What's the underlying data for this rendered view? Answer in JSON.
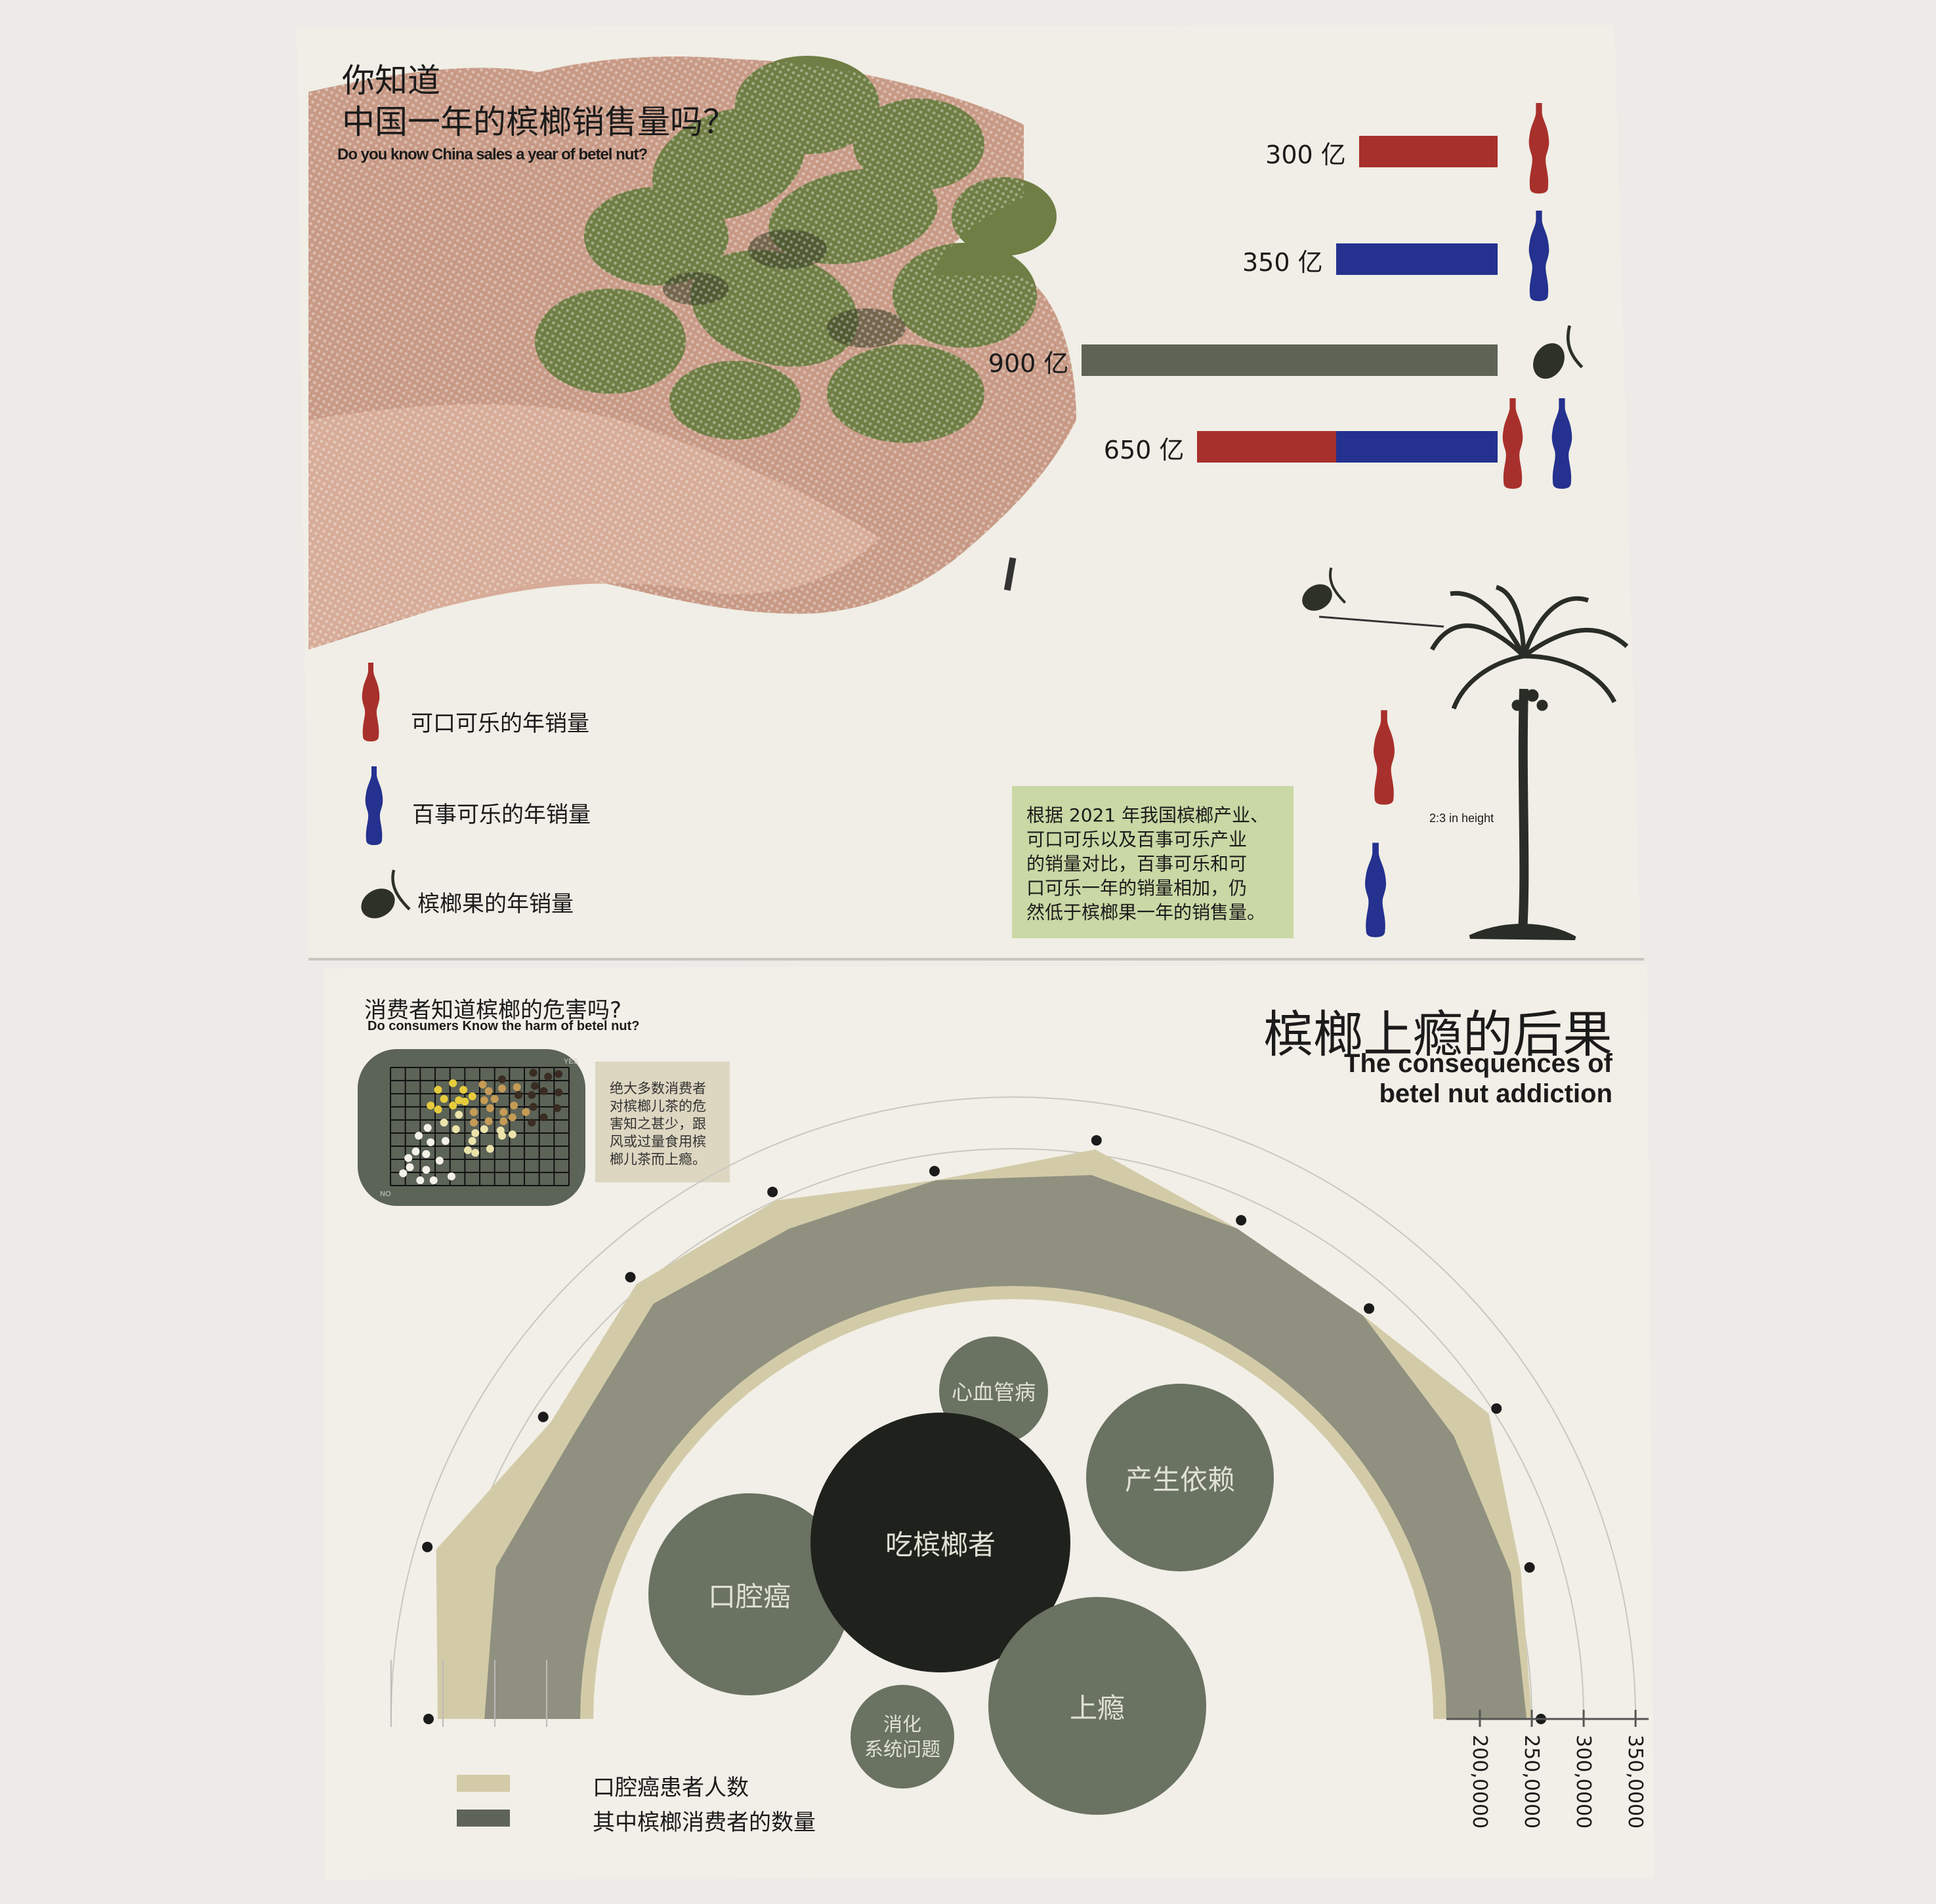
{
  "top_page": {
    "title_line1": "你知道",
    "title_line2": "中国一年的槟榔销售量吗？",
    "title_en": "Do you know China sales a year of betel nut?",
    "legend": [
      {
        "icon": "coca-cola-bottle-icon",
        "label": "可口可乐的年销量"
      },
      {
        "icon": "pepsi-bottle-icon",
        "label": "百事可乐的年销量"
      },
      {
        "icon": "betel-nut-icon",
        "label": "槟榔果的年销量"
      }
    ],
    "note_lines": [
      "根据 2021 年我国槟榔产业、",
      "可口可乐以及百事可乐产业",
      "的销量对比，百事可乐和可",
      "口可乐一年的销量相加，仍",
      "然低于槟榔果一年的销售量。"
    ],
    "height_note": "2:3 in height"
  },
  "bottom_page": {
    "question_title": "消费者知道槟榔的危害吗?",
    "question_en": "Do consumers Know the harm of betel nut?",
    "beige_note_lines": [
      "绝大多数消费者",
      "对槟榔儿茶的危",
      "害知之甚少，跟",
      "风或过量食用槟",
      "榔儿茶而上瘾。"
    ],
    "big_title": "槟榔上瘾的后果",
    "big_title_en_line1": "The consequences of",
    "big_title_en_line2": "betel nut addiction",
    "bubbles": {
      "center": "吃槟榔者",
      "cardio": "心血管病",
      "dependence": "产生依赖",
      "oral_cancer": "口腔癌",
      "addiction": "上瘾",
      "digestive_line1": "消化",
      "digestive_line2": "系统问题"
    },
    "legend": [
      {
        "label": "口腔癌患者人数",
        "color": "#d3cba8"
      },
      {
        "label": "其中槟榔消费者的数量",
        "color": "#5f6458"
      }
    ]
  },
  "colors": {
    "coca_cola": "#a8302c",
    "pepsi": "#24318f",
    "betel": "#5e6356",
    "note_green": "#c9d8a5"
  },
  "chart_data": [
    {
      "type": "bar",
      "orientation": "horizontal",
      "unit": "亿",
      "bars": [
        {
          "label": "300 亿",
          "icons": [
            "coca-cola"
          ],
          "segments": [
            {
              "name": "可口可乐",
              "value": 300,
              "color": "#a8302c"
            }
          ]
        },
        {
          "label": "350 亿",
          "icons": [
            "pepsi"
          ],
          "segments": [
            {
              "name": "百事可乐",
              "value": 350,
              "color": "#24318f"
            }
          ]
        },
        {
          "label": "900 亿",
          "icons": [
            "betel-nut"
          ],
          "segments": [
            {
              "name": "槟榔果",
              "value": 900,
              "color": "#5e6356"
            }
          ]
        },
        {
          "label": "650 亿",
          "icons": [
            "coca-cola",
            "pepsi"
          ],
          "segments": [
            {
              "name": "可口可乐",
              "value": 300,
              "color": "#a8302c"
            },
            {
              "name": "百事可乐",
              "value": 350,
              "color": "#24318f"
            }
          ]
        }
      ]
    },
    {
      "type": "scatter",
      "xlabel": "",
      "ylabel": "",
      "corner_labels": {
        "top_right": "YES",
        "bottom_left": "NO"
      },
      "grid": true,
      "xlim": [
        0,
        12
      ],
      "ylim": [
        0,
        9
      ],
      "groups": [
        {
          "color": "#f4f2e8",
          "points": [
            [
              0.85,
              0.94
            ],
            [
              1.3,
              1.4
            ],
            [
              2.0,
              0.4
            ],
            [
              2.9,
              0.4
            ],
            [
              2.4,
              1.2
            ],
            [
              1.2,
              2.1
            ],
            [
              2.4,
              2.4
            ],
            [
              1.7,
              2.6
            ],
            [
              3.3,
              1.9
            ],
            [
              4.1,
              0.7
            ],
            [
              2.7,
              3.3
            ],
            [
              3.7,
              3.4
            ],
            [
              1.9,
              3.8
            ],
            [
              2.5,
              4.4
            ]
          ]
        },
        {
          "color": "#ebe3aa",
          "points": [
            [
              3.6,
              4.8
            ],
            [
              4.4,
              4.3
            ],
            [
              4.6,
              5.4
            ],
            [
              5.5,
              3.4
            ],
            [
              5.2,
              2.7
            ],
            [
              5.7,
              2.5
            ],
            [
              6.7,
              2.8
            ],
            [
              5.7,
              4.0
            ],
            [
              6.3,
              4.3
            ],
            [
              7.5,
              3.8
            ],
            [
              8.2,
              3.9
            ],
            [
              7.4,
              4.2
            ]
          ]
        },
        {
          "color": "#e6cc3c",
          "points": [
            [
              3.2,
              5.8
            ],
            [
              2.7,
              6.1
            ],
            [
              3.2,
              7.3
            ],
            [
              4.2,
              7.8
            ],
            [
              4.9,
              7.3
            ],
            [
              3.6,
              6.6
            ],
            [
              4.2,
              6.1
            ],
            [
              4.6,
              6.5
            ],
            [
              5.0,
              6.4
            ],
            [
              5.5,
              6.8
            ]
          ]
        },
        {
          "color": "#c59b56",
          "points": [
            [
              5.6,
              5.6
            ],
            [
              6.3,
              6.5
            ],
            [
              6.7,
              5.9
            ],
            [
              5.6,
              4.8
            ],
            [
              6.6,
              4.9
            ],
            [
              7.0,
              6.6
            ],
            [
              6.2,
              7.7
            ],
            [
              6.6,
              7.2
            ],
            [
              7.5,
              7.4
            ],
            [
              7.6,
              5.6
            ],
            [
              8.3,
              6.1
            ],
            [
              8.5,
              7.5
            ],
            [
              9.1,
              5.6
            ],
            [
              7.6,
              4.9
            ],
            [
              8.2,
              5.2
            ]
          ]
        },
        {
          "color": "#3a2c22",
          "points": [
            [
              7.5,
              8.1
            ],
            [
              8.6,
              6.9
            ],
            [
              9.6,
              8.6
            ],
            [
              10.6,
              8.3
            ],
            [
              11.3,
              8.5
            ],
            [
              9.7,
              7.6
            ],
            [
              10.3,
              7.2
            ],
            [
              9.5,
              6.9
            ],
            [
              11.3,
              7.1
            ],
            [
              9.6,
              6.0
            ],
            [
              11.2,
              5.9
            ],
            [
              10.3,
              5.2
            ],
            [
              9.5,
              4.8
            ]
          ]
        }
      ]
    },
    {
      "type": "area",
      "layout": "radial-semicircle",
      "radial_ticks": [
        "200,0000",
        "250,0000",
        "300,0000",
        "350,0000"
      ],
      "radial_tick_values": [
        2000000,
        2500000,
        3000000,
        3500000
      ],
      "rlim": [
        1500000,
        3500000
      ],
      "series": [
        {
          "name": "口腔癌患者人数",
          "color": "#d3cba8",
          "values": [
            3050000,
            3300000,
            2800000,
            3050000,
            3000000,
            2750000,
            3050000,
            2700000,
            2650000,
            2950000,
            2600000,
            2500000
          ]
        },
        {
          "name": "其中槟榔消费者的数量",
          "color": "#8f907f",
          "values": [
            2600000,
            2700000,
            2550000,
            2800000,
            2700000,
            2750000,
            2800000,
            2700000,
            2650000,
            2550000,
            2500000,
            2450000
          ]
        }
      ]
    }
  ]
}
